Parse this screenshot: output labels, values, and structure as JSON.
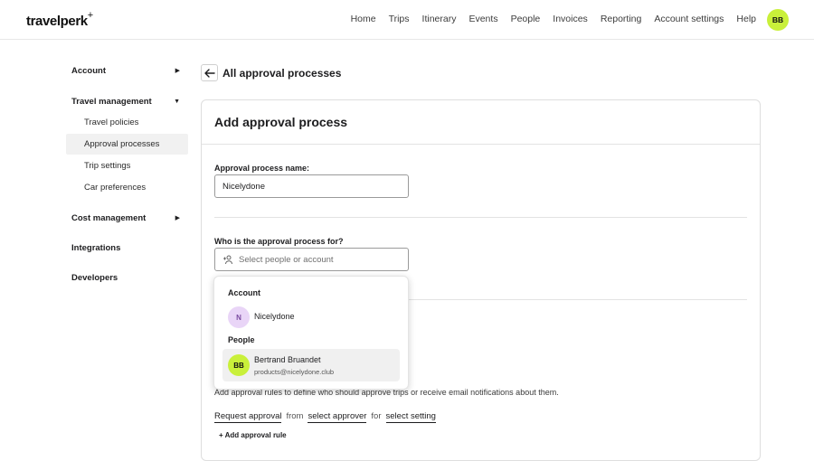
{
  "brand": {
    "logo_text": "travelperk",
    "logo_plus": "+"
  },
  "nav": {
    "items": [
      "Home",
      "Trips",
      "Itinerary",
      "Events",
      "People",
      "Invoices",
      "Reporting",
      "Account settings",
      "Help"
    ],
    "avatar_initials": "BB",
    "avatar_color": "#c9f03a"
  },
  "sidebar": {
    "account": "Account",
    "travel_management": "Travel management",
    "travel_sub": [
      "Travel policies",
      "Approval processes",
      "Trip settings",
      "Car preferences"
    ],
    "active_item": "Approval processes",
    "cost_management": "Cost management",
    "integrations": "Integrations",
    "developers": "Developers"
  },
  "header": {
    "back_title": "All approval processes"
  },
  "form": {
    "title": "Add approval process",
    "name_label": "Approval process name:",
    "name_value": "Nicelydone",
    "who_label": "Who is the approval process for?",
    "who_placeholder": "Select people or account"
  },
  "dropdown": {
    "group_account": "Account",
    "account_option": {
      "initial": "N",
      "name": "Nicelydone",
      "avatar_color": "#e9d5f7"
    },
    "group_people": "People",
    "people_option": {
      "initials": "BB",
      "name": "Bertrand Bruandet",
      "email": "products@nicelydone.club",
      "avatar_color": "#c9f03a"
    }
  },
  "rules": {
    "description": "Add approval rules to define who should approve trips or receive email notifications about them.",
    "request": "Request approval",
    "from": "from",
    "approver": "select approver",
    "for": "for",
    "setting": "select setting",
    "add_rule": "+ Add approval rule"
  }
}
